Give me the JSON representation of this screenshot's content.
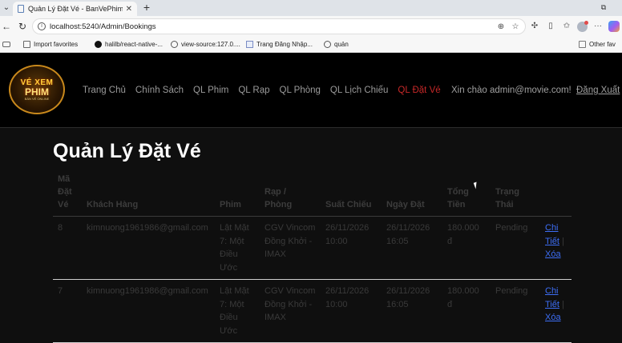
{
  "browser": {
    "tab_title": "Quản Lý Đặt Vé - BanVePhimOnline",
    "url": "localhost:5240/Admin/Bookings",
    "favorites": [
      {
        "label": "Import favorites",
        "icon": "import-icon"
      },
      {
        "label": "halilb/react-native-...",
        "icon": "github-icon"
      },
      {
        "label": "view-source:127.0....",
        "icon": "globe-icon"
      },
      {
        "label": "Trang Đăng Nhập...",
        "icon": "document-icon"
      },
      {
        "label": "quản",
        "icon": "globe-icon"
      }
    ],
    "other_favorites": "Other favorites",
    "other_favorites_partial": "Other fav"
  },
  "site": {
    "logo": {
      "line1": "VÉ XEM",
      "line2": "PHIM",
      "line3": "BÁN VÉ ONLINE"
    },
    "nav": [
      {
        "label": "Trang Chủ",
        "active": false
      },
      {
        "label": "Chính Sách",
        "active": false
      },
      {
        "label": "QL Phim",
        "active": false
      },
      {
        "label": "QL Rạp",
        "active": false
      },
      {
        "label": "QL Phòng",
        "active": false
      },
      {
        "label": "QL Lịch Chiếu",
        "active": false
      },
      {
        "label": "QL Đặt Vé",
        "active": true
      }
    ],
    "greeting": "Xin chào admin@movie.com!",
    "logout": "Đăng Xuất",
    "accent_color": "#c62828"
  },
  "main": {
    "title": "Quản Lý Đặt Vé",
    "table": {
      "headers": [
        "Mã Đặt Vé",
        "Khách Hàng",
        "Phim",
        "Rạp / Phòng",
        "Suất Chiếu",
        "Ngày Đặt",
        "Tổng Tiền",
        "Trạng Thái",
        ""
      ],
      "rows": [
        {
          "id": "8",
          "customer": "kimnuong1961986@gmail.com",
          "movie": "Lật Mặt 7: Một Điều Ước",
          "room": "CGV Vincom Đồng Khởi - IMAX",
          "showtime": "26/11/2026 10:00",
          "booked": "26/11/2026 16:05",
          "total": "180.000 đ",
          "status": "Pending",
          "detail_label": "Chi Tiết",
          "delete_label": "Xóa"
        },
        {
          "id": "7",
          "customer": "kimnuong1961986@gmail.com",
          "movie": "Lật Mặt 7: Một Điều Ước",
          "room": "CGV Vincom Đồng Khởi - IMAX",
          "showtime": "26/11/2026 10:00",
          "booked": "26/11/2026 16:05",
          "total": "180.000 đ",
          "status": "Pending",
          "detail_label": "Chi Tiết",
          "delete_label": "Xóa"
        }
      ]
    }
  }
}
